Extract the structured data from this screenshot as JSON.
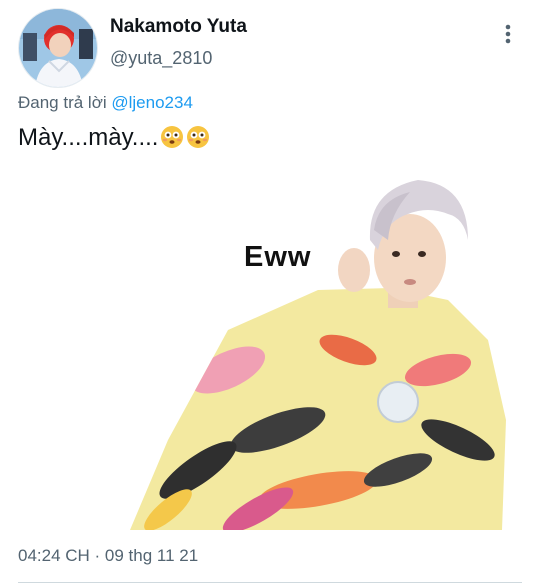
{
  "tweet": {
    "author_name": "Nakamoto Yuta",
    "author_handle": "@yuta_2810",
    "reply_prefix": "Đang trả lời",
    "reply_to": "@ljeno234",
    "text": "Mày....mày....",
    "emojis": [
      "flushed-face-emoji",
      "flushed-face-emoji"
    ],
    "media": {
      "caption": "Eww"
    },
    "timestamp": "04:24 CH · 09 thg 11 21"
  },
  "icons": {
    "more": "vertical-dots-icon"
  },
  "colors": {
    "link": "#1d9bf0",
    "secondary_text": "#536471",
    "primary_text": "#0f1419"
  }
}
